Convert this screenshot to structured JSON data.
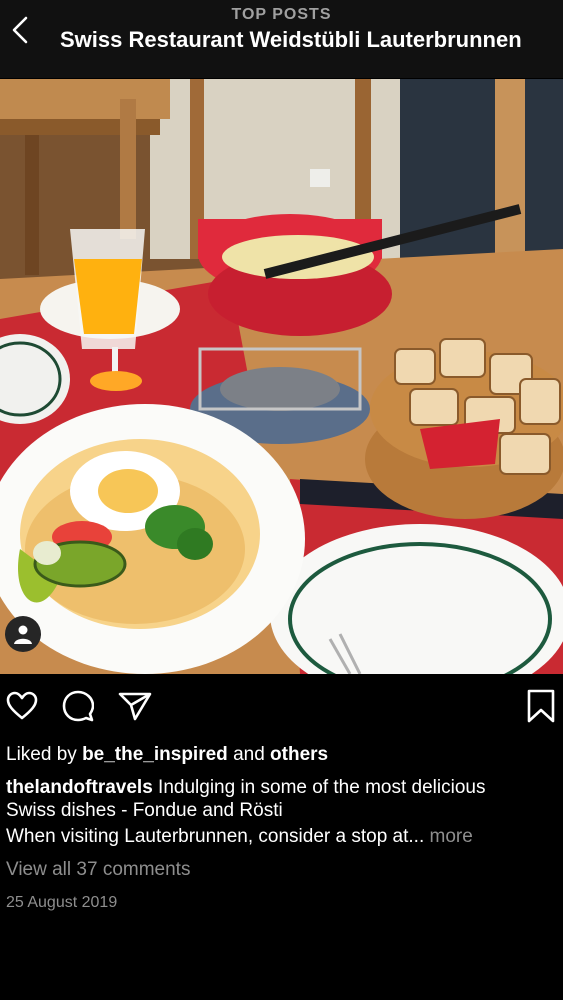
{
  "header": {
    "subtitle": "TOP POSTS",
    "title": "Swiss Restaurant Weidstübli Lauterbrunnen"
  },
  "icons": {
    "back": "chevron-left-icon",
    "like": "heart-icon",
    "comment": "comment-bubble-icon",
    "share": "paper-plane-icon",
    "save": "bookmark-icon",
    "avatar": "user-icon"
  },
  "post": {
    "liked_prefix": "Liked by",
    "liked_user": "be_the_inspired",
    "liked_and": "and",
    "liked_others": "others",
    "author": "thelandoftravels",
    "caption_line1": "Indulging in some of the most delicious",
    "caption_line2": "Swiss dishes - Fondue and Rösti",
    "caption_line3": "When visiting Lauterbrunnen, consider a stop at...",
    "more": "more",
    "view_comments": "View all 37 comments",
    "date": "25 August 2019"
  }
}
